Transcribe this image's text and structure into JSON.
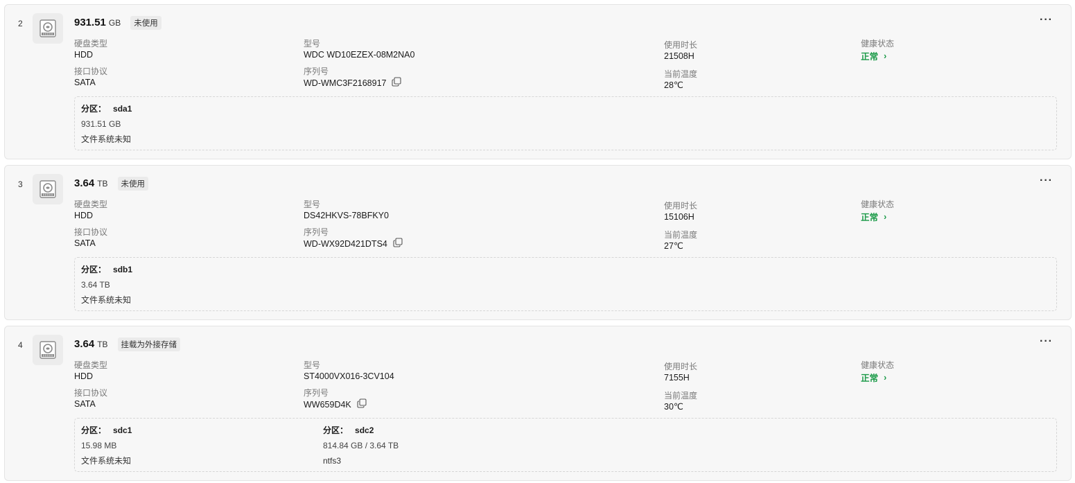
{
  "labels": {
    "disk_type": "硬盘类型",
    "model": "型号",
    "uptime": "使用时长",
    "health": "健康状态",
    "interface": "接口协议",
    "serial": "序列号",
    "temperature": "当前温度",
    "partition_prefix": "分区："
  },
  "more_icon": "ellipsis-icon",
  "health_color": "#1a9a47",
  "disks": [
    {
      "index": "2",
      "size": "931.51",
      "unit": "GB",
      "status": "未使用",
      "disk_type": "HDD",
      "model": "WDC WD10EZEX-08M2NA0",
      "uptime": "21508H",
      "health": "正常",
      "interface": "SATA",
      "serial": "WD-WMC3F2168917",
      "temperature": "28℃",
      "partitions": [
        {
          "name": "sda1",
          "size": "931.51 GB",
          "fs": "文件系统未知"
        }
      ]
    },
    {
      "index": "3",
      "size": "3.64",
      "unit": "TB",
      "status": "未使用",
      "disk_type": "HDD",
      "model": "DS42HKVS-78BFKY0",
      "uptime": "15106H",
      "health": "正常",
      "interface": "SATA",
      "serial": "WD-WX92D421DTS4",
      "temperature": "27℃",
      "partitions": [
        {
          "name": "sdb1",
          "size": "3.64 TB",
          "fs": "文件系统未知"
        }
      ]
    },
    {
      "index": "4",
      "size": "3.64",
      "unit": "TB",
      "status": "挂载为外接存储",
      "disk_type": "HDD",
      "model": "ST4000VX016-3CV104",
      "uptime": "7155H",
      "health": "正常",
      "interface": "SATA",
      "serial": "WW659D4K",
      "temperature": "30℃",
      "partitions": [
        {
          "name": "sdc1",
          "size": "15.98 MB",
          "fs": "文件系统未知"
        },
        {
          "name": "sdc2",
          "size": "814.84 GB / 3.64 TB",
          "fs": "ntfs3"
        }
      ]
    }
  ]
}
